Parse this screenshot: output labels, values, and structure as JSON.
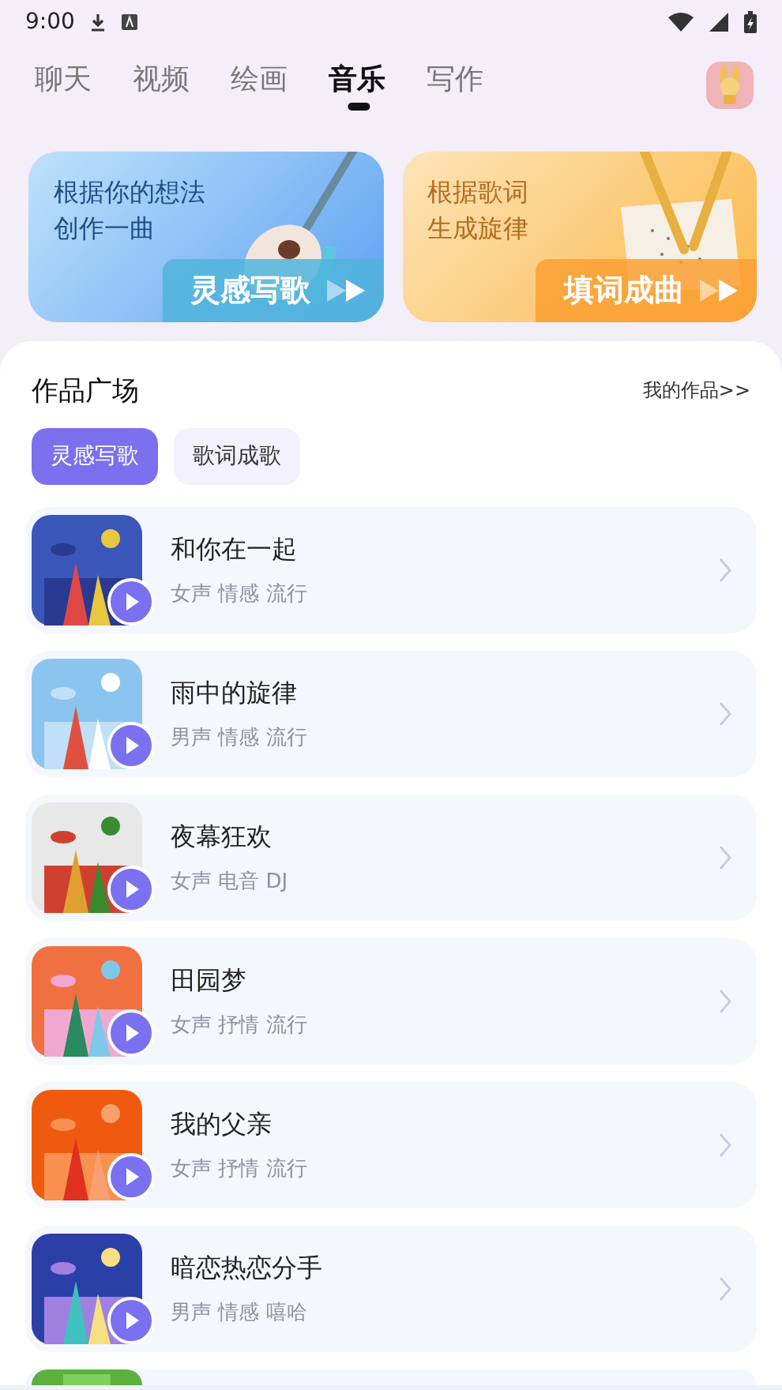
{
  "status_bar": {
    "time": "9:00"
  },
  "tabs": [
    {
      "label": "聊天",
      "selected": false
    },
    {
      "label": "视频",
      "selected": false
    },
    {
      "label": "绘画",
      "selected": false
    },
    {
      "label": "音乐",
      "selected": true
    },
    {
      "label": "写作",
      "selected": false
    }
  ],
  "banners": [
    {
      "kind": "inspiration",
      "lines": [
        "根据你的想法",
        "创作一曲"
      ],
      "action": "灵感写歌"
    },
    {
      "kind": "lyrics",
      "lines": [
        "根据歌词",
        "生成旋律"
      ],
      "action": "填词成曲"
    }
  ],
  "gallery": {
    "title": "作品广场",
    "my_works_link": "我的作品>>",
    "filters": [
      {
        "label": "灵感写歌",
        "selected": true
      },
      {
        "label": "歌词成歌",
        "selected": false
      }
    ],
    "songs": [
      {
        "title": "和你在一起",
        "tags": "女声 情感 流行"
      },
      {
        "title": "雨中的旋律",
        "tags": "男声 情感 流行"
      },
      {
        "title": "夜幕狂欢",
        "tags": "女声 电音 DJ"
      },
      {
        "title": "田园梦",
        "tags": "女声 抒情 流行"
      },
      {
        "title": "我的父亲",
        "tags": "女声 抒情 流行"
      },
      {
        "title": "暗恋热恋分手",
        "tags": "男声 情感 嘻哈"
      }
    ]
  }
}
